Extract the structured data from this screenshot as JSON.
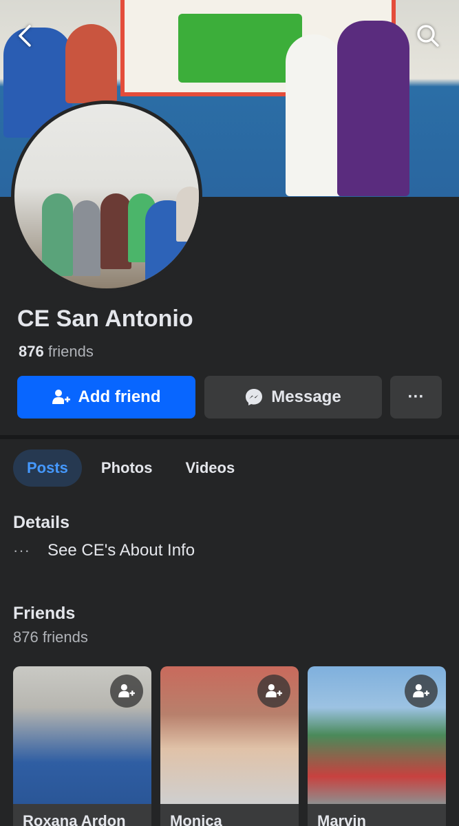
{
  "header": {
    "back_icon": "chevron-left-icon",
    "search_icon": "search-icon"
  },
  "profile": {
    "name": "CE San Antonio",
    "friends_number": "876",
    "friends_word": "friends"
  },
  "actions": {
    "add_friend": "Add friend",
    "message": "Message",
    "more": "···"
  },
  "tabs": [
    {
      "label": "Posts",
      "active": true
    },
    {
      "label": "Photos",
      "active": false
    },
    {
      "label": "Videos",
      "active": false
    }
  ],
  "details": {
    "title": "Details",
    "about_dots": "···",
    "about_label": "See CE's About Info"
  },
  "friends": {
    "title": "Friends",
    "count_label": "876 friends",
    "items": [
      {
        "name": "Roxana Ardon"
      },
      {
        "name": "Monica"
      },
      {
        "name": "Marvin"
      }
    ]
  },
  "colors": {
    "background": "#242526",
    "primary_button": "#0866ff",
    "secondary_button": "#3a3b3c",
    "active_tab_bg": "#263951",
    "active_tab_text": "#4599ff"
  }
}
